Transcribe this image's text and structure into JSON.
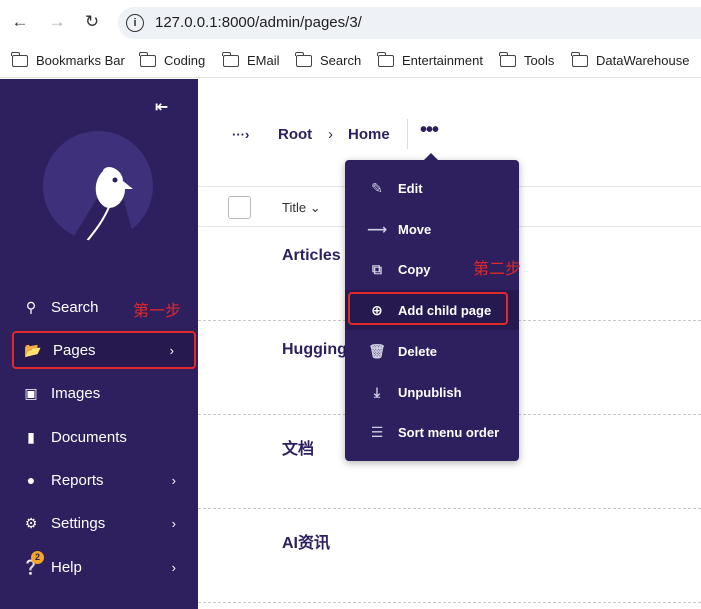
{
  "browser": {
    "url": "127.0.0.1:8000/admin/pages/3/",
    "bookmarks": [
      "Bookmarks Bar",
      "Coding",
      "EMail",
      "Search",
      "Entertainment",
      "Tools",
      "DataWarehouse"
    ]
  },
  "sidebar": {
    "items": [
      {
        "label": "Search"
      },
      {
        "label": "Pages"
      },
      {
        "label": "Images"
      },
      {
        "label": "Documents"
      },
      {
        "label": "Reports"
      },
      {
        "label": "Settings"
      },
      {
        "label": "Help"
      }
    ],
    "help_badge": "2",
    "step1": "第一步"
  },
  "breadcrumb": {
    "root": "Root",
    "home": "Home"
  },
  "table": {
    "title_header": "Title",
    "rows": [
      "Articles",
      "Hugging",
      "文档",
      "AI资讯"
    ]
  },
  "menu": {
    "items": [
      "Edit",
      "Move",
      "Copy",
      "Add child page",
      "Delete",
      "Unpublish",
      "Sort menu order"
    ],
    "step2": "第二步"
  },
  "colors": {
    "brand": "#2e1f5e",
    "highlight": "#e0292a"
  }
}
